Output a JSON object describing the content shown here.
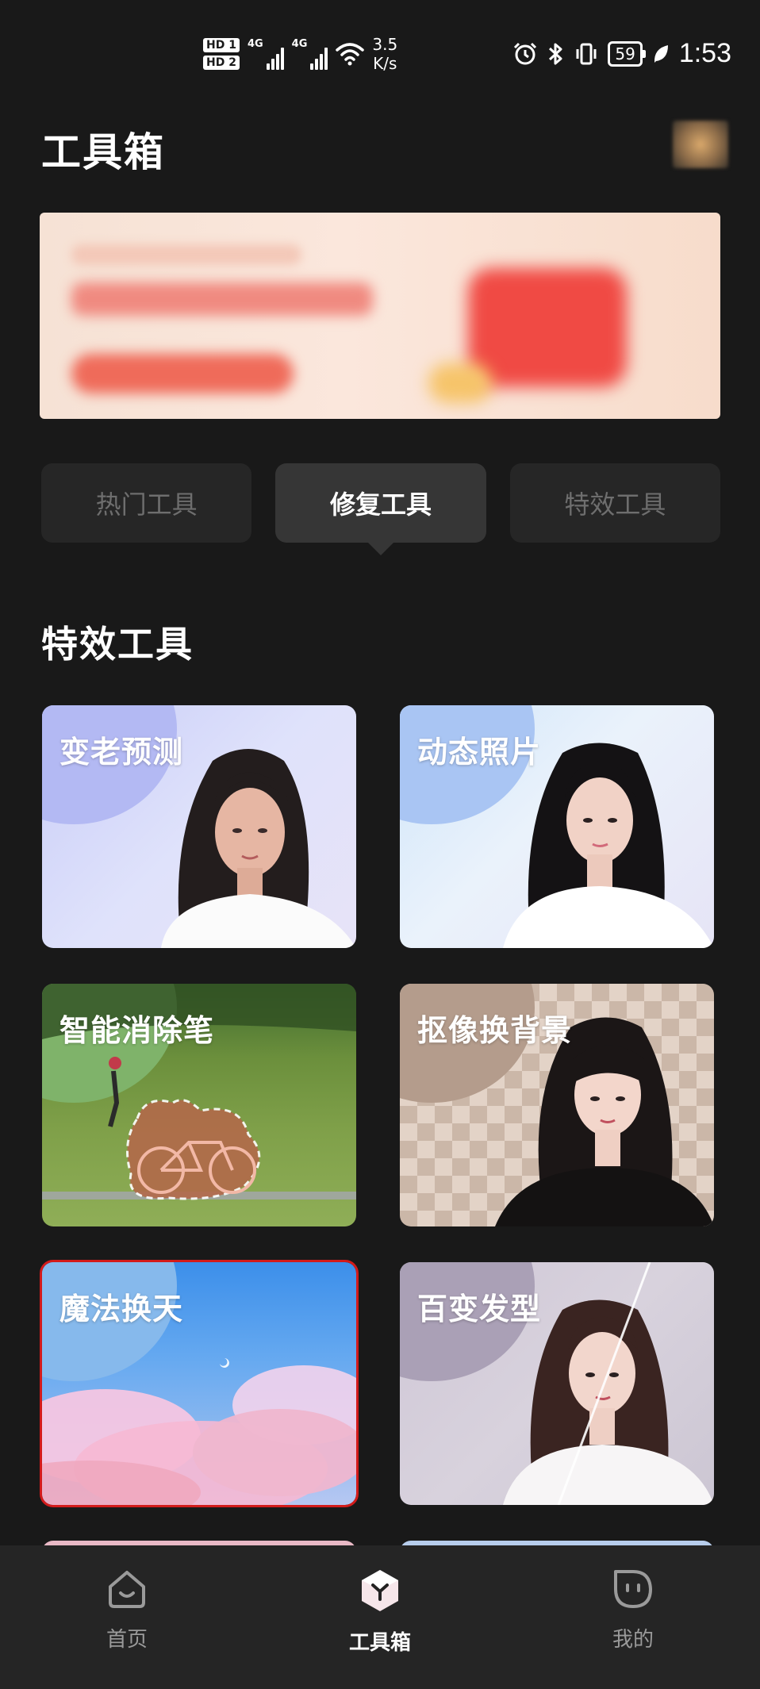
{
  "status_bar": {
    "sim1": "HD 1",
    "sim2": "HD 2",
    "net1": "4G",
    "net2": "4G",
    "speed_value": "3.5",
    "speed_unit": "K/s",
    "battery": "59",
    "time": "1:53",
    "icons": [
      "alarm-icon",
      "bluetooth-icon",
      "vibrate-icon",
      "battery-icon",
      "leaf-icon"
    ]
  },
  "header": {
    "title": "工具箱"
  },
  "tabs": [
    {
      "label": "热门工具",
      "active": false
    },
    {
      "label": "修复工具",
      "active": true
    },
    {
      "label": "特效工具",
      "active": false
    }
  ],
  "section": {
    "title": "特效工具"
  },
  "tools": [
    {
      "label": "变老预测",
      "selected": false
    },
    {
      "label": "动态照片",
      "selected": false
    },
    {
      "label": "智能消除笔",
      "selected": false
    },
    {
      "label": "抠像换背景",
      "selected": false
    },
    {
      "label": "魔法换天",
      "selected": true
    },
    {
      "label": "百变发型",
      "selected": false
    }
  ],
  "bottom_nav": [
    {
      "label": "首页",
      "icon": "home-icon",
      "active": false
    },
    {
      "label": "工具箱",
      "icon": "toolbox-icon",
      "active": true
    },
    {
      "label": "我的",
      "icon": "profile-icon",
      "active": false
    }
  ],
  "colors": {
    "background": "#191919",
    "selection_outline": "#d31b1b",
    "tab_active": "#363636",
    "tab_inactive": "#262626"
  }
}
